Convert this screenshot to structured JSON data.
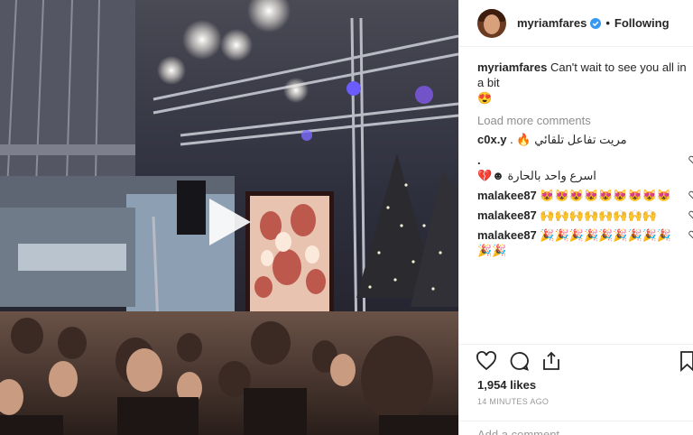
{
  "post": {
    "username": "myriamfares",
    "follow_status": "Following",
    "separator": "•"
  },
  "caption": {
    "username": "myriamfares",
    "text": "Can't wait to see you all in a bit",
    "emoji": "😍"
  },
  "comments": {
    "load_more": "Load more comments",
    "items": [
      {
        "username": "c0x.y",
        "text": "مريت تفاعل تلقائي 🔥 ."
      },
      {
        "username": ".",
        "text": "اسرع واحد بالحارة ☻💔"
      },
      {
        "username": "malakee87",
        "text": "😻😻😻😻😻😻😻😻😻"
      },
      {
        "username": "malakee87",
        "text": "🙌🙌🙌🙌🙌🙌🙌🙌"
      },
      {
        "username": "malakee87",
        "text": "🎉🎉🎉🎉🎉🎉🎉🎉🎉🎉🎉"
      }
    ]
  },
  "stats": {
    "likes": "1,954 likes",
    "time": "14 MINUTES AGO"
  },
  "input": {
    "placeholder": "Add a comment..."
  },
  "icons": {
    "like": "heart-icon",
    "comment": "comment-icon",
    "share": "share-icon",
    "save": "bookmark-icon",
    "play": "play-icon",
    "verified": "verified-badge-icon"
  },
  "colors": {
    "verified": "#3897f0",
    "muted": "#8e8e8e",
    "text": "#262626"
  }
}
